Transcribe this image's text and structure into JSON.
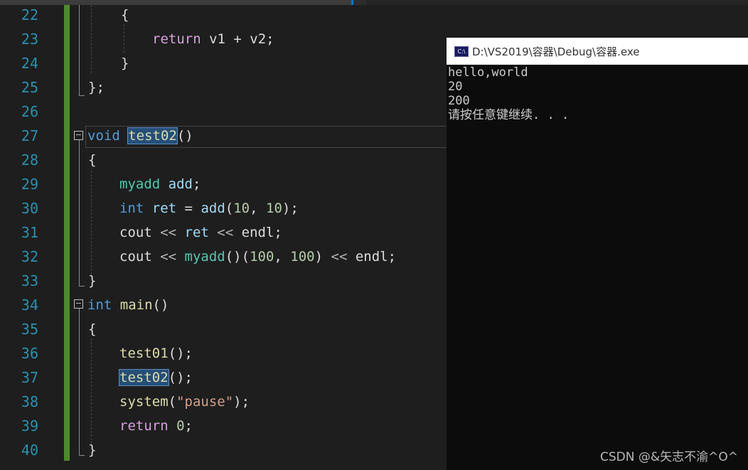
{
  "editor": {
    "line_numbers": [
      "22",
      "23",
      "24",
      "25",
      "26",
      "27",
      "28",
      "29",
      "30",
      "31",
      "32",
      "33",
      "34",
      "35",
      "36",
      "37",
      "38",
      "39",
      "40"
    ],
    "code": {
      "l22": "{",
      "l23_return": "return",
      "l23_rest": " v1 + v2;",
      "l24": "}",
      "l25": "};",
      "l27_void": "void",
      "l27_name": "test02",
      "l27_paren": "()",
      "l28": "{",
      "l29_type": "myadd",
      "l29_var": "add",
      "l29_semi": ";",
      "l30_type": "int",
      "l30_var": "ret",
      "l30_eq": " = ",
      "l30_fn": "add",
      "l30_open": "(",
      "l30_a": "10",
      "l30_comma": ", ",
      "l30_b": "10",
      "l30_close": ");",
      "l31_cout": "cout",
      "l31_op1": " << ",
      "l31_var": "ret",
      "l31_op2": " << ",
      "l31_endl": "endl;",
      "l32_cout": "cout",
      "l32_op1": " << ",
      "l32_type": "myadd",
      "l32_call": "()(",
      "l32_a": "100",
      "l32_comma": ", ",
      "l32_b": "100",
      "l32_close": ")",
      "l32_op2": " << ",
      "l32_endl": "endl;",
      "l33": "}",
      "l34_int": "int",
      "l34_main": "main",
      "l34_paren": "()",
      "l35": "{",
      "l36_fn": "test01",
      "l36_rest": "();",
      "l37_fn": "test02",
      "l37_rest": "();",
      "l38_fn": "system",
      "l38_open": "(",
      "l38_str": "\"pause\"",
      "l38_close": ");",
      "l39_return": "return",
      "l39_num": "0",
      "l39_semi": ";",
      "l40": "}"
    },
    "fold_symbol": "−"
  },
  "console": {
    "icon_label": "C:\\",
    "title": "D:\\VS2019\\容器\\Debug\\容器.exe",
    "output": [
      "hello,world",
      "20",
      "200",
      "请按任意键继续. . ."
    ]
  },
  "watermark": "CSDN @&矢志不渝^O^"
}
